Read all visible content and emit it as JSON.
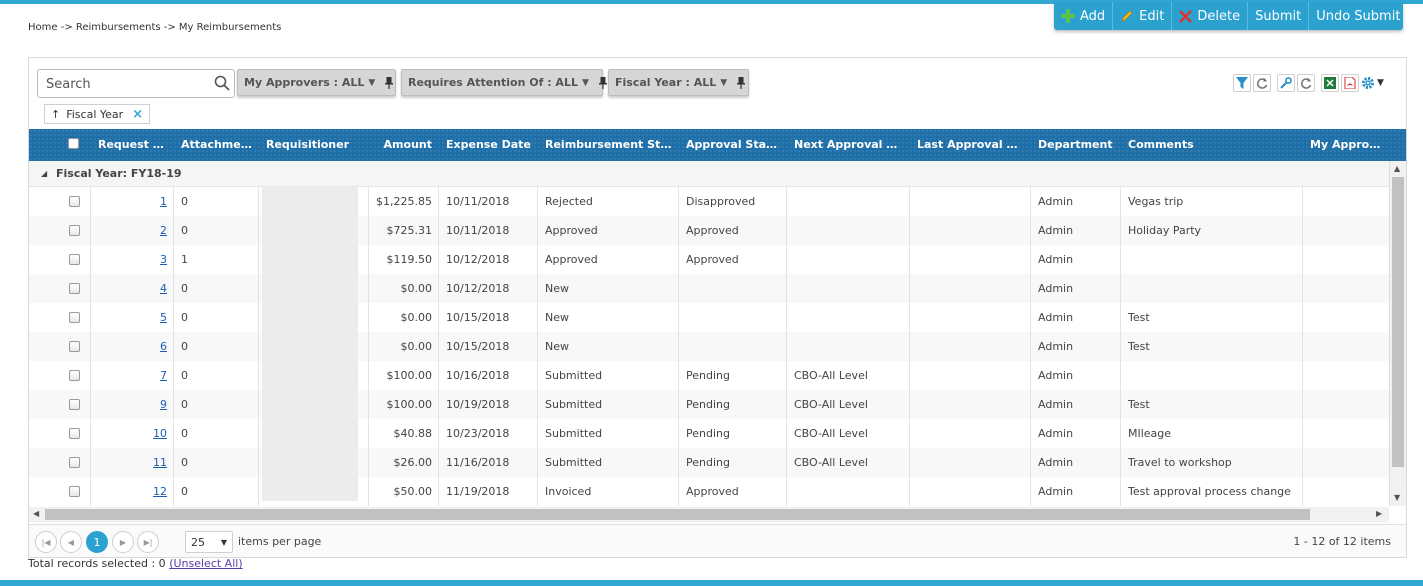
{
  "breadcrumb": "Home -> Reimbursements -> My Reimbursements",
  "toolbar": {
    "add": "Add",
    "edit": "Edit",
    "delete": "Delete",
    "submit": "Submit",
    "undo_submit": "Undo Submit"
  },
  "search": {
    "placeholder": "Search",
    "value": ""
  },
  "filters": [
    {
      "label": "My Approvers : ALL"
    },
    {
      "label": "Requires Attention Of : ALL"
    },
    {
      "label": "Fiscal Year : ALL"
    }
  ],
  "group_by": {
    "label": "Fiscal Year"
  },
  "columns": [
    "Request N...",
    "Attachme...",
    "Requisitioner",
    "Amount",
    "Expense Date",
    "Reimbursement Stat...",
    "Approval Status",
    "Next Approval Le...",
    "Last Approval Le...",
    "Department",
    "Comments",
    "My Approvers"
  ],
  "group_row": "Fiscal Year: FY18-19",
  "rows": [
    {
      "request": "1",
      "attachments": "0",
      "amount": "$1,225.85",
      "date": "10/11/2018",
      "reimb_status": "Rejected",
      "approval_status": "Disapproved",
      "next_level": "",
      "last_level": "",
      "department": "Admin",
      "comments": "Vegas trip",
      "my_approvers": ""
    },
    {
      "request": "2",
      "attachments": "0",
      "amount": "$725.31",
      "date": "10/11/2018",
      "reimb_status": "Approved",
      "approval_status": "Approved",
      "next_level": "",
      "last_level": "",
      "department": "Admin",
      "comments": "Holiday Party",
      "my_approvers": ""
    },
    {
      "request": "3",
      "attachments": "1",
      "amount": "$119.50",
      "date": "10/12/2018",
      "reimb_status": "Approved",
      "approval_status": "Approved",
      "next_level": "",
      "last_level": "",
      "department": "Admin",
      "comments": "",
      "my_approvers": ""
    },
    {
      "request": "4",
      "attachments": "0",
      "amount": "$0.00",
      "date": "10/12/2018",
      "reimb_status": "New",
      "approval_status": "",
      "next_level": "",
      "last_level": "",
      "department": "Admin",
      "comments": "",
      "my_approvers": ""
    },
    {
      "request": "5",
      "attachments": "0",
      "amount": "$0.00",
      "date": "10/15/2018",
      "reimb_status": "New",
      "approval_status": "",
      "next_level": "",
      "last_level": "",
      "department": "Admin",
      "comments": "Test",
      "my_approvers": ""
    },
    {
      "request": "6",
      "attachments": "0",
      "amount": "$0.00",
      "date": "10/15/2018",
      "reimb_status": "New",
      "approval_status": "",
      "next_level": "",
      "last_level": "",
      "department": "Admin",
      "comments": "Test",
      "my_approvers": ""
    },
    {
      "request": "7",
      "attachments": "0",
      "amount": "$100.00",
      "date": "10/16/2018",
      "reimb_status": "Submitted",
      "approval_status": "Pending",
      "next_level": "CBO-All Level",
      "last_level": "",
      "department": "Admin",
      "comments": "",
      "my_approvers": ""
    },
    {
      "request": "9",
      "attachments": "0",
      "amount": "$100.00",
      "date": "10/19/2018",
      "reimb_status": "Submitted",
      "approval_status": "Pending",
      "next_level": "CBO-All Level",
      "last_level": "",
      "department": "Admin",
      "comments": "Test",
      "my_approvers": ""
    },
    {
      "request": "10",
      "attachments": "0",
      "amount": "$40.88",
      "date": "10/23/2018",
      "reimb_status": "Submitted",
      "approval_status": "Pending",
      "next_level": "CBO-All Level",
      "last_level": "",
      "department": "Admin",
      "comments": "MIleage",
      "my_approvers": ""
    },
    {
      "request": "11",
      "attachments": "0",
      "amount": "$26.00",
      "date": "11/16/2018",
      "reimb_status": "Submitted",
      "approval_status": "Pending",
      "next_level": "CBO-All Level",
      "last_level": "",
      "department": "Admin",
      "comments": "Travel to workshop",
      "my_approvers": ""
    },
    {
      "request": "12",
      "attachments": "0",
      "amount": "$50.00",
      "date": "11/19/2018",
      "reimb_status": "Invoiced",
      "approval_status": "Approved",
      "next_level": "",
      "last_level": "",
      "department": "Admin",
      "comments": "Test approval process change",
      "my_approvers": ""
    }
  ],
  "pager": {
    "current_page": "1",
    "page_size": "25",
    "items_per_page_label": "items per page",
    "info": "1 - 12 of 12 items"
  },
  "footer": {
    "selected_text": "Total records selected : 0",
    "unselect_label": "(Unselect All)"
  },
  "colors": {
    "accent": "#2aa1cf",
    "header": "#1f6fa8",
    "link": "#1a5fb4"
  },
  "icons": [
    "plus-icon",
    "pencil-icon",
    "x-icon",
    "search-icon",
    "pin-icon",
    "filter-icon",
    "refresh-icon",
    "wrench-icon",
    "excel-icon",
    "pdf-icon",
    "gear-icon"
  ]
}
